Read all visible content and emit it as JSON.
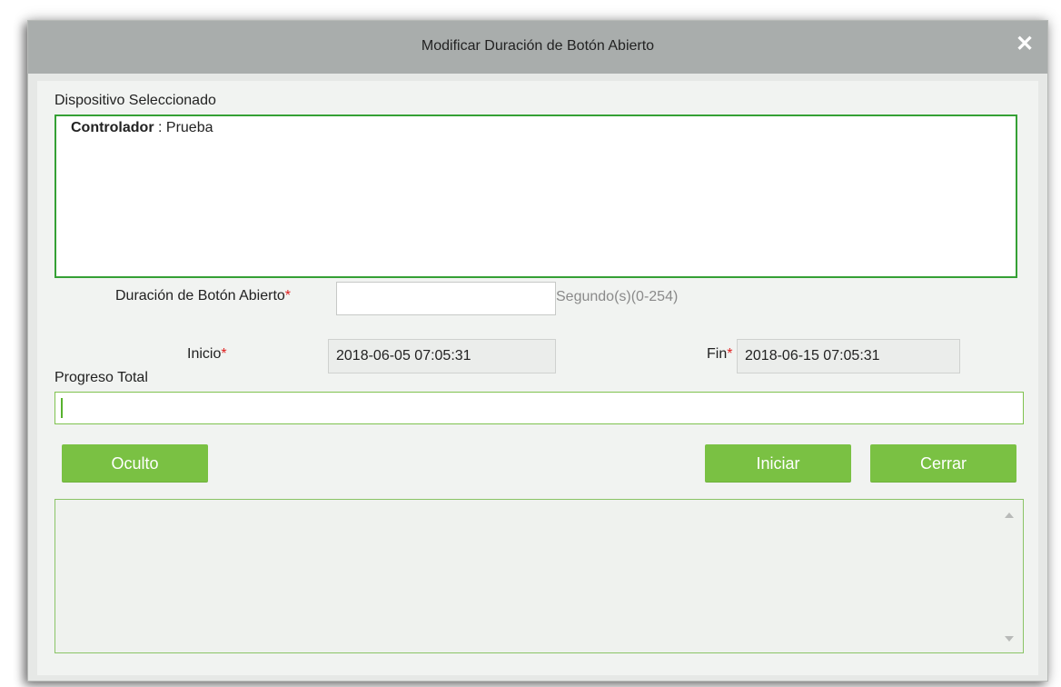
{
  "dialog": {
    "title": "Modificar Duración de Botón Abierto",
    "close_icon": "close-icon",
    "close_glyph": "✕"
  },
  "device": {
    "section_label": "Dispositivo Seleccionado",
    "controller_key": "Controlador",
    "controller_sep": " : ",
    "controller_value": "Prueba"
  },
  "form": {
    "duration_label": "Duración de Botón Abierto",
    "duration_value": "",
    "duration_hint": "Segundo(s)(0-254)",
    "required_mark": "*",
    "start_label": "Inicio",
    "start_value": "2018-06-05 07:05:31",
    "end_label": "Fin",
    "end_value": "2018-06-15 07:05:31"
  },
  "progress": {
    "label": "Progreso Total",
    "value": 0
  },
  "buttons": {
    "hide": "Oculto",
    "start": "Iniciar",
    "close": "Cerrar"
  },
  "colors": {
    "accent_green": "#7ac143",
    "required_red": "#e02020"
  }
}
